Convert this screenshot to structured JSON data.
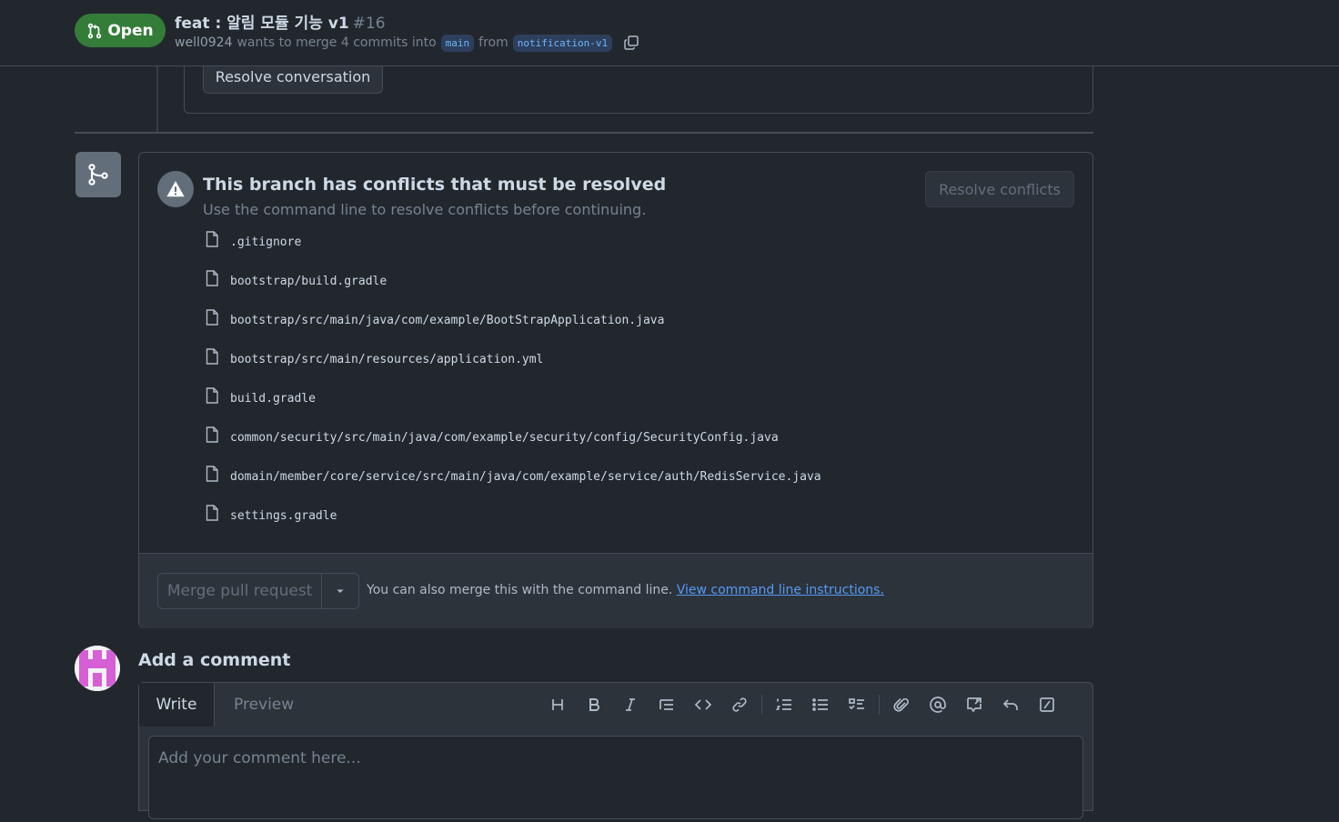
{
  "header": {
    "state_label": "Open",
    "title": "feat : 알림 모듈 기능 v1",
    "number": "#16",
    "author": "well0924",
    "merge_text": "wants to merge 4 commits into",
    "base_branch": "main",
    "from_text": "from",
    "head_branch": "notification-v1"
  },
  "thread": {
    "resolve_label": "Resolve conversation"
  },
  "merge_box": {
    "title": "This branch has conflicts that must be resolved",
    "description": "Use the command line to resolve conflicts before continuing.",
    "resolve_conflicts_label": "Resolve conflicts",
    "conflicting_files": [
      ".gitignore",
      "bootstrap/build.gradle",
      "bootstrap/src/main/java/com/example/BootStrapApplication.java",
      "bootstrap/src/main/resources/application.yml",
      "build.gradle",
      "common/security/src/main/java/com/example/security/config/SecurityConfig.java",
      "domain/member/core/service/src/main/java/com/example/service/auth/RedisService.java",
      "settings.gradle"
    ],
    "merge_button_label": "Merge pull request",
    "merge_hint": "You can also merge this with the command line.",
    "merge_hint_link": "View command line instructions."
  },
  "comment": {
    "title": "Add a comment",
    "tabs": {
      "write": "Write",
      "preview": "Preview"
    },
    "placeholder": "Add your comment here...",
    "toolbar_icons": [
      "heading-icon",
      "bold-icon",
      "italic-icon",
      "quote-icon",
      "code-icon",
      "link-icon",
      "ordered-list-icon",
      "unordered-list-icon",
      "task-list-icon",
      "attach-icon",
      "mention-icon",
      "reference-icon",
      "saved-reply-icon",
      "slash-command-icon"
    ]
  },
  "colors": {
    "background": "#22272e",
    "open_badge": "#347d39",
    "link": "#539bf5",
    "border": "#444c56"
  }
}
